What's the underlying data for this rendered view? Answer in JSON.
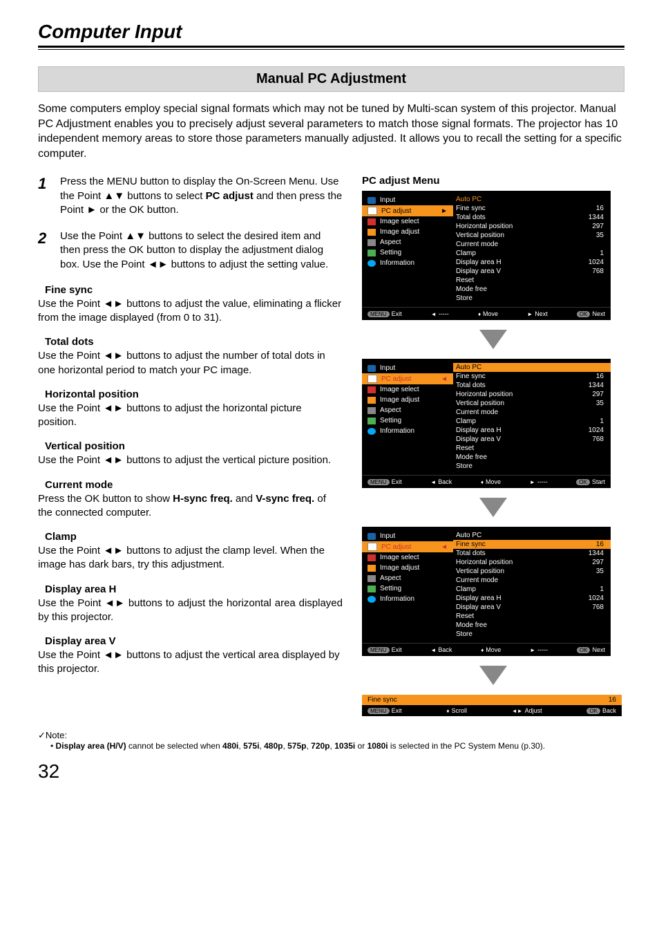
{
  "title": "Computer Input",
  "subheader": "Manual PC Adjustment",
  "intro": "Some computers employ special signal formats which may not be tuned by Multi-scan system of this projector.  Manual PC Adjustment enables you to precisely adjust several parameters to match those signal formats. The projector has 10 independent memory areas to store those parameters manually adjusted. It allows you to recall the setting for a specific computer.",
  "step1": {
    "n": "1",
    "txt_a": "Press the MENU button to display the On-Screen Menu. Use the Point ▲▼ buttons to select ",
    "b": "PC adjust",
    "txt_b": "  and then press the Point ► or the OK button."
  },
  "step2": {
    "n": "2",
    "txt": "Use the Point ▲▼ buttons to select  the desired item and then press the OK button to display the adjustment dialog box. Use the Point ◄► buttons to adjust the setting value."
  },
  "sec": {
    "fs": {
      "h": "Fine sync",
      "p": "Use the Point ◄► buttons to adjust the value, eliminating a flicker from the image displayed (from 0 to 31)."
    },
    "td": {
      "h": "Total dots",
      "p": "Use the Point ◄► buttons to adjust the number of total dots in one horizontal period to match your PC image."
    },
    "hp": {
      "h": "Horizontal position",
      "p": "Use the Point ◄► buttons to adjust the horizontal picture position."
    },
    "vp": {
      "h": "Vertical position",
      "p": "Use the Point ◄► buttons to adjust the vertical picture position."
    },
    "cm": {
      "h": "Current mode",
      "p_a": "Press the OK button to show ",
      "b1": "H-sync freq.",
      "mid": " and ",
      "b2": "V-sync freq.",
      "p_b": " of the connected computer."
    },
    "cl": {
      "h": "Clamp",
      "p": "Use the Point ◄► buttons to adjust the clamp level. When the image has dark bars, try this adjustment."
    },
    "dh": {
      "h": "Display area H",
      "p": "Use the Point ◄► buttons to adjust the horizontal area displayed by this projector."
    },
    "dv": {
      "h": "Display area V",
      "p": "Use the Point ◄► buttons to adjust the vertical area displayed by this projector."
    }
  },
  "menutitle": "PC adjust Menu",
  "side": [
    "Input",
    "PC adjust",
    "Image select",
    "Image adjust",
    "Aspect",
    "Setting",
    "Information"
  ],
  "vals": [
    {
      "l": "Auto PC",
      "v": ""
    },
    {
      "l": "Fine sync",
      "v": "16"
    },
    {
      "l": "Total dots",
      "v": "1344"
    },
    {
      "l": "Horizontal position",
      "v": "297"
    },
    {
      "l": "Vertical position",
      "v": "35"
    },
    {
      "l": "Current mode",
      "v": ""
    },
    {
      "l": "Clamp",
      "v": "1"
    },
    {
      "l": "Display area H",
      "v": "1024"
    },
    {
      "l": "Display area V",
      "v": "768"
    },
    {
      "l": "Reset",
      "v": ""
    },
    {
      "l": "Mode free",
      "v": ""
    },
    {
      "l": "Store",
      "v": ""
    }
  ],
  "foot": {
    "exit": "Exit",
    "back": "Back",
    "move": "Move",
    "next": "Next",
    "start": "Start",
    "dash": "-----"
  },
  "bar": {
    "l": "Fine sync",
    "v": "16"
  },
  "bar2": {
    "exit": "Exit",
    "scroll": "Scroll",
    "adjust": "Adjust",
    "back": "Back"
  },
  "note": {
    "h": "✓Note:",
    "a": "Display area (H/V)",
    "b": " cannot be selected when ",
    "m1": "480i",
    "c": ", ",
    "m2": "575i",
    "m3": "480p",
    "m4": "575p",
    "m5": "720p",
    "m6": "1035i",
    "d": " or ",
    "m7": "1080i",
    "e": " is selected in the PC System Menu (p.30)."
  },
  "pagenum": "32"
}
